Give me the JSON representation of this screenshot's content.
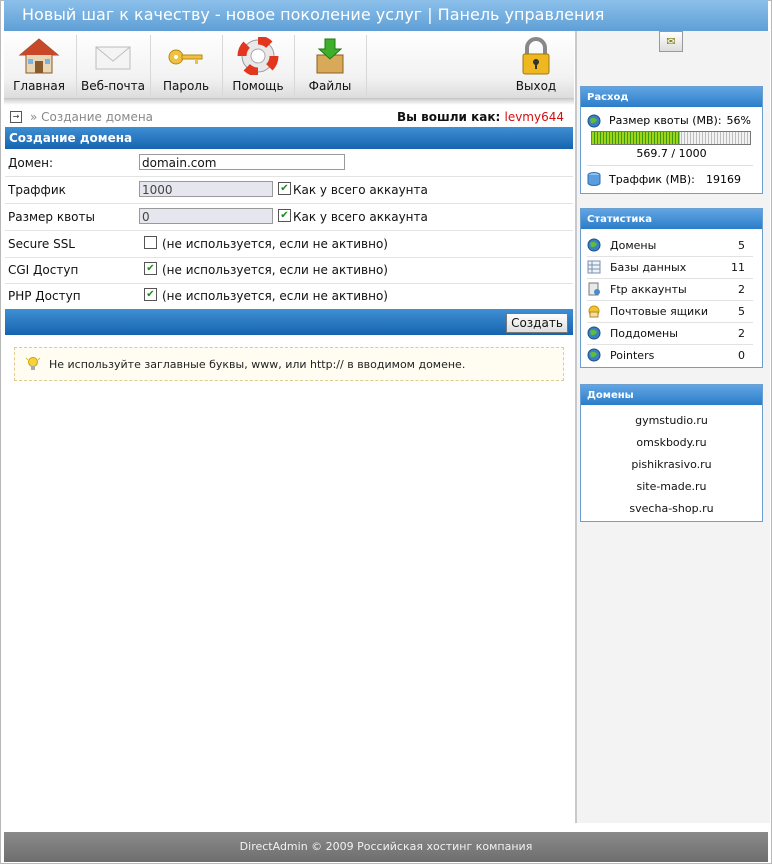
{
  "header": {
    "title": "Новый шаг к качеству - новое поколение услуг | Панель управления"
  },
  "toolbar": {
    "items": [
      {
        "label": "Главная",
        "icon": "house-icon"
      },
      {
        "label": "Веб-почта",
        "icon": "envelope-icon"
      },
      {
        "label": "Пароль",
        "icon": "keys-icon"
      },
      {
        "label": "Помощь",
        "icon": "lifebuoy-icon"
      },
      {
        "label": "Файлы",
        "icon": "box-download-icon"
      },
      {
        "label": "Выход",
        "icon": "padlock-icon"
      }
    ]
  },
  "breadcrumb": {
    "text": "» Создание домена"
  },
  "login": {
    "prefix": "Вы вошли как:",
    "user": "levmy644"
  },
  "form": {
    "title": "Создание домена",
    "domain": {
      "label": "Домен:",
      "value": "domain.com"
    },
    "traffic": {
      "label": "Траффик",
      "value": "1000",
      "checkbox_label": "Как у всего аккаунта",
      "checked": true
    },
    "quota": {
      "label": "Размер квоты",
      "value": "0",
      "checkbox_label": "Как у всего аккаунта",
      "checked": true
    },
    "ssl": {
      "label": "Secure SSL",
      "checkbox_label": "(не используется, если не активно)",
      "checked": false
    },
    "cgi": {
      "label": "CGI Доступ",
      "checkbox_label": "(не используется, если не активно)",
      "checked": true
    },
    "php": {
      "label": "PHP Доступ",
      "checkbox_label": "(не используется, если не активно)",
      "checked": true
    },
    "submit_label": "Создать"
  },
  "hint": {
    "text": "Не используйте заглавные буквы, www, или http:// в вводимом домене."
  },
  "usage": {
    "title": "Расход",
    "quota_label": "Размер квоты (MB):",
    "quota_percent": "56%",
    "quota_fraction": 0.56,
    "quota_amount": "569.7 / 1000",
    "traffic_label": "Траффик (MB):",
    "traffic_value": "19169"
  },
  "stats": {
    "title": "Статистика",
    "items": [
      {
        "label": "Домены",
        "value": "5",
        "icon": "globe-icon"
      },
      {
        "label": "Базы данных",
        "value": "11",
        "icon": "database-table-icon"
      },
      {
        "label": "Ftp аккаунты",
        "value": "2",
        "icon": "ftp-icon"
      },
      {
        "label": "Почтовые ящики",
        "value": "5",
        "icon": "mailbox-icon"
      },
      {
        "label": "Поддомены",
        "value": "2",
        "icon": "subdomain-globe-icon"
      },
      {
        "label": "Pointers",
        "value": "0",
        "icon": "pointer-globe-icon"
      }
    ]
  },
  "domains": {
    "title": "Домены",
    "items": [
      "gymstudio.ru",
      "omskbody.ru",
      "pishikrasivo.ru",
      "site-made.ru",
      "svecha-shop.ru"
    ]
  },
  "footer": {
    "text": "DirectAdmin © 2009 Российская хостинг компания"
  }
}
